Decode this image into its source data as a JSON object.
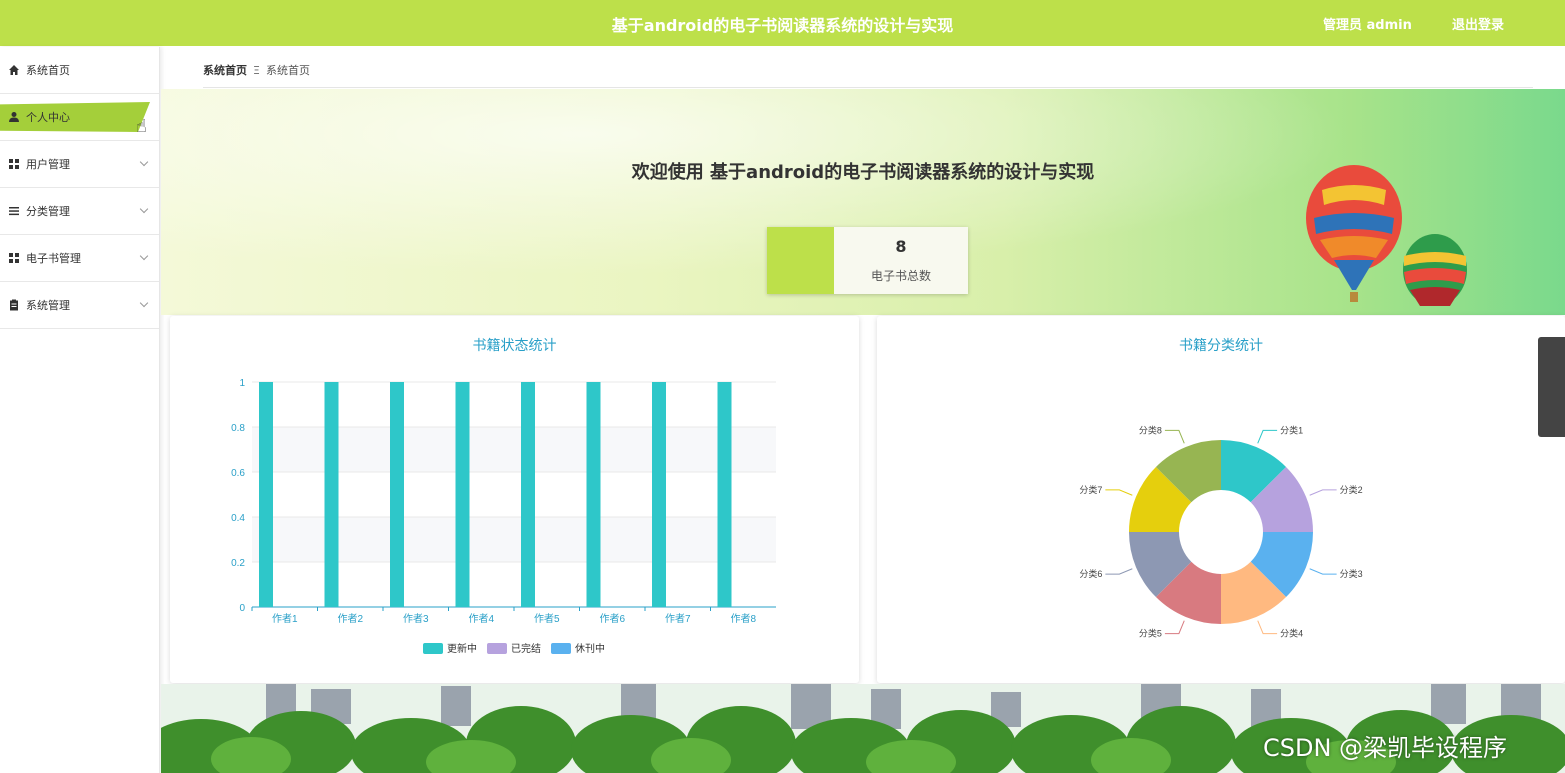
{
  "header": {
    "title": "基于android的电子书阅读器系统的设计与实现",
    "admin_label": "管理员 admin",
    "logout_label": "退出登录"
  },
  "sidebar": {
    "items": [
      {
        "label": "系统首页",
        "icon": "home-icon"
      },
      {
        "label": "个人中心",
        "icon": "user-icon",
        "active": true
      },
      {
        "label": "用户管理",
        "icon": "grid-icon"
      },
      {
        "label": "分类管理",
        "icon": "list-icon"
      },
      {
        "label": "电子书管理",
        "icon": "grid-icon"
      },
      {
        "label": "系统管理",
        "icon": "clipboard-icon"
      }
    ]
  },
  "breadcrumb": {
    "root": "系统首页",
    "separator": "Ξ",
    "current": "系统首页"
  },
  "welcome": {
    "text": "欢迎使用 基于android的电子书阅读器系统的设计与实现"
  },
  "stat": {
    "value": "8",
    "label": "电子书总数"
  },
  "panels": {
    "left_title": "书籍状态统计",
    "right_title": "书籍分类统计"
  },
  "watermark": "CSDN @梁凯毕设程序",
  "colors": {
    "accent": "#bde04a",
    "title_blue": "#2aa0c8"
  },
  "chart_data": [
    {
      "type": "bar",
      "title": "书籍状态统计",
      "categories": [
        "作者1",
        "作者2",
        "作者3",
        "作者4",
        "作者5",
        "作者6",
        "作者7",
        "作者8"
      ],
      "series": [
        {
          "name": "更新中",
          "values": [
            1,
            1,
            1,
            1,
            1,
            1,
            1,
            1
          ],
          "color": "#2ec7c9"
        },
        {
          "name": "已完结",
          "values": [
            0,
            0,
            0,
            0,
            0,
            0,
            0,
            0
          ],
          "color": "#b6a2de"
        },
        {
          "name": "休刊中",
          "values": [
            0,
            0,
            0,
            0,
            0,
            0,
            0,
            0
          ],
          "color": "#5ab1ef"
        }
      ],
      "yticks": [
        "0",
        "0.2",
        "0.4",
        "0.6",
        "0.8",
        "1"
      ],
      "ylim": [
        0,
        1
      ],
      "legend": "bottom"
    },
    {
      "type": "pie",
      "title": "书籍分类统计",
      "donut": true,
      "slices": [
        {
          "label": "分类1",
          "value": 1,
          "color": "#2ec7c9"
        },
        {
          "label": "分类2",
          "value": 1,
          "color": "#b6a2de"
        },
        {
          "label": "分类3",
          "value": 1,
          "color": "#5ab1ef"
        },
        {
          "label": "分类4",
          "value": 1,
          "color": "#ffb980"
        },
        {
          "label": "分类5",
          "value": 1,
          "color": "#d87a80"
        },
        {
          "label": "分类6",
          "value": 1,
          "color": "#8d98b3"
        },
        {
          "label": "分类7",
          "value": 1,
          "color": "#e5cf0d"
        },
        {
          "label": "分类8",
          "value": 1,
          "color": "#97b552"
        }
      ]
    }
  ]
}
